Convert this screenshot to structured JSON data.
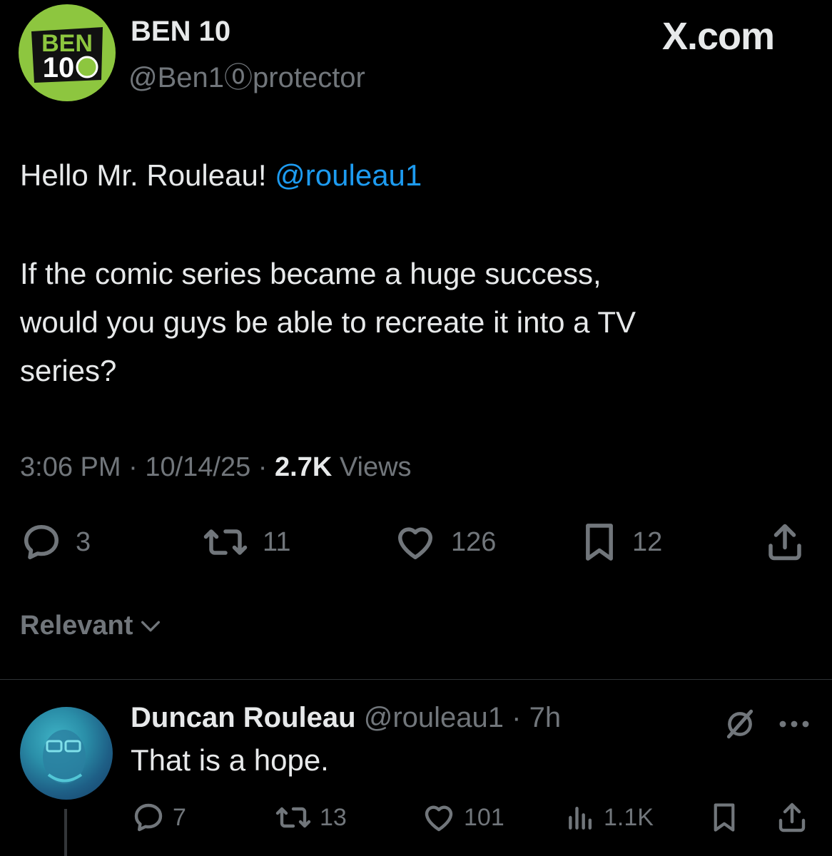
{
  "tweet": {
    "author_name": "BEN 10",
    "author_handle": "@Ben1⓪protector",
    "avatar_logo_text": "BEN 10",
    "site_label": "X.com",
    "body": {
      "greeting": "Hello Mr. Rouleau!",
      "mention": "@rouleau1",
      "line2": "If the comic series became a huge success,",
      "line3": "would you guys be able to recreate it into a TV",
      "line4": "series?"
    },
    "meta": {
      "time": "3:06 PM",
      "date": "10/14/25",
      "views_count": "2.7K",
      "views_label": "Views",
      "separator": "·"
    },
    "actions": {
      "replies": "3",
      "reposts": "11",
      "likes": "126",
      "bookmarks": "12"
    }
  },
  "sort": {
    "label": "Relevant"
  },
  "reply": {
    "author_name": "Duncan Rouleau",
    "author_handle": "@rouleau1",
    "age": "· 7h",
    "text": "That is a hope.",
    "actions": {
      "replies": "7",
      "reposts": "13",
      "likes": "101",
      "views": "1.1K"
    }
  },
  "colors": {
    "background": "#000000",
    "text": "#e7e9ea",
    "muted": "#71767b",
    "link": "#1d9bf0",
    "brand_green": "#8dc63f"
  }
}
